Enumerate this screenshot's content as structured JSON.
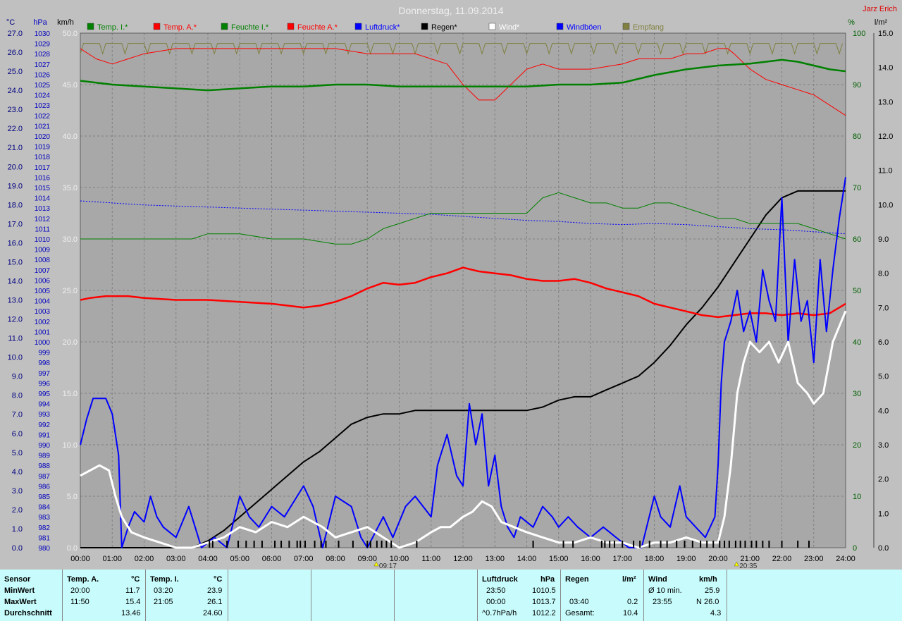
{
  "chart_data": {
    "type": "line",
    "title": "Donnerstag, 11.09.2014",
    "corner_label": "Jarz Erich",
    "axis_units": {
      "temp": "°C",
      "pressure": "hPa",
      "wind": "km/h",
      "humidity": "%",
      "rain": "l/m²"
    },
    "legend": [
      {
        "name": "Temp. I.*",
        "color": "#008000"
      },
      {
        "name": "Temp. A.*",
        "color": "#ff0000"
      },
      {
        "name": "Feuchte I.*",
        "color": "#008000"
      },
      {
        "name": "Feuchte A.*",
        "color": "#ff0000"
      },
      {
        "name": "Luftdruck*",
        "color": "#0000ff"
      },
      {
        "name": "Regen*",
        "color": "#000000"
      },
      {
        "name": "Wind*",
        "color": "#ffffff"
      },
      {
        "name": "Windböen",
        "color": "#0000ff"
      },
      {
        "name": "Empfang",
        "color": "#808040"
      }
    ],
    "x_ticks": [
      "00:00",
      "01:00",
      "02:00",
      "03:00",
      "04:00",
      "05:00",
      "06:00",
      "07:00",
      "08:00",
      "09:00",
      "10:00",
      "11:00",
      "12:00",
      "13:00",
      "14:00",
      "15:00",
      "16:00",
      "17:00",
      "18:00",
      "19:00",
      "20:00",
      "21:00",
      "22:00",
      "23:00",
      "24:00"
    ],
    "markers": [
      {
        "label": "09:17",
        "x": 9.28
      },
      {
        "label": "20:35",
        "x": 20.58
      }
    ],
    "temp_axis": {
      "min": 0,
      "max": 27,
      "step": 1
    },
    "pressure_axis": {
      "min": 980,
      "max": 1030,
      "step": 1
    },
    "wind_axis": {
      "min": 0,
      "max": 50,
      "step": 5
    },
    "humidity_axis": {
      "min": 0,
      "max": 100,
      "step": 10
    },
    "rain_axis": {
      "min": 0,
      "max": 15,
      "step": 1
    },
    "series": [
      {
        "name": "Temp. A.*",
        "axis": "temp",
        "color": "#ff0000",
        "width": 2.5,
        "x": [
          0,
          0.3,
          0.8,
          1.5,
          2,
          3,
          4,
          5,
          6,
          7,
          7.5,
          8,
          8.5,
          9,
          9.5,
          10,
          10.5,
          11,
          11.5,
          12,
          12.5,
          13,
          13.5,
          14,
          14.5,
          15,
          15.5,
          16,
          16.5,
          17,
          17.5,
          18,
          18.5,
          19,
          19.5,
          20,
          20.5,
          21,
          21.5,
          22,
          22.5,
          23,
          23.5,
          24
        ],
        "y": [
          13.0,
          13.1,
          13.2,
          13.2,
          13.1,
          13.0,
          13.0,
          12.9,
          12.8,
          12.6,
          12.7,
          12.9,
          13.2,
          13.6,
          13.9,
          13.8,
          13.9,
          14.2,
          14.4,
          14.7,
          14.5,
          14.4,
          14.3,
          14.1,
          14.0,
          14.0,
          14.1,
          13.9,
          13.6,
          13.4,
          13.2,
          12.8,
          12.6,
          12.4,
          12.2,
          12.1,
          12.2,
          12.3,
          12.3,
          12.2,
          12.3,
          12.2,
          12.3,
          12.8
        ]
      },
      {
        "name": "Temp. I.*",
        "axis": "temp",
        "color": "#008000",
        "width": 2.5,
        "x": [
          0,
          1,
          2,
          3,
          4,
          5,
          6,
          7,
          8,
          9,
          10,
          11,
          12,
          13,
          14,
          15,
          16,
          17,
          18,
          19,
          20,
          21,
          21.5,
          22,
          22.5,
          23,
          23.5,
          24
        ],
        "y": [
          24.5,
          24.3,
          24.2,
          24.1,
          24.0,
          24.1,
          24.2,
          24.2,
          24.3,
          24.3,
          24.2,
          24.2,
          24.2,
          24.2,
          24.2,
          24.3,
          24.3,
          24.4,
          24.8,
          25.1,
          25.3,
          25.4,
          25.5,
          25.6,
          25.5,
          25.3,
          25.1,
          25.0
        ]
      },
      {
        "name": "Feuchte A.*",
        "axis": "humidity",
        "color": "#ff0000",
        "width": 1,
        "x": [
          0,
          0.5,
          1,
          1.5,
          2,
          3,
          4,
          5,
          6,
          7,
          8,
          9,
          10,
          10.5,
          11,
          11.5,
          12,
          12.5,
          13,
          13.5,
          14,
          14.5,
          15,
          15.5,
          16,
          17,
          17.5,
          18,
          18.5,
          19,
          19.5,
          20,
          20.3,
          20.5,
          21,
          21.5,
          22,
          22.5,
          23,
          23.5,
          24
        ],
        "y": [
          97,
          95,
          94,
          95,
          96,
          97,
          97,
          97,
          97,
          97,
          97,
          96,
          96,
          96,
          95,
          94,
          90,
          87,
          87,
          90,
          93,
          94,
          93,
          93,
          93,
          94,
          95,
          95,
          95,
          96,
          96,
          97,
          97,
          96,
          93,
          91,
          90,
          89,
          88,
          86,
          84
        ]
      },
      {
        "name": "Feuchte I.*",
        "axis": "humidity",
        "color": "#008000",
        "width": 1,
        "x": [
          0,
          1,
          2,
          3,
          3.5,
          4,
          4.5,
          5,
          6,
          7,
          8,
          8.5,
          9,
          9.5,
          10,
          10.5,
          11,
          11.5,
          12,
          12.5,
          13,
          13.5,
          14,
          14.5,
          15,
          15.5,
          16,
          16.5,
          17,
          17.5,
          18,
          18.5,
          19,
          19.5,
          20,
          20.5,
          21,
          21.5,
          22,
          22.5,
          23,
          23.5,
          24
        ],
        "y": [
          60,
          60,
          60,
          60,
          60,
          61,
          61,
          61,
          60,
          60,
          59,
          59,
          60,
          62,
          63,
          64,
          65,
          65,
          65,
          65,
          65,
          65,
          65,
          68,
          69,
          68,
          67,
          67,
          66,
          66,
          67,
          67,
          66,
          65,
          64,
          64,
          63,
          63,
          63,
          63,
          62,
          61,
          60
        ]
      },
      {
        "name": "Luftdruck*",
        "axis": "pressure",
        "color": "#0000ff",
        "width": 1,
        "dash": "2,2",
        "x": [
          0,
          1,
          2,
          3,
          4,
          5,
          6,
          7,
          8,
          9,
          10,
          11,
          12,
          13,
          14,
          15,
          16,
          17,
          18,
          19,
          20,
          21,
          22,
          23,
          24
        ],
        "y": [
          1013.7,
          1013.5,
          1013.3,
          1013.2,
          1013.1,
          1013.0,
          1012.9,
          1012.8,
          1012.7,
          1012.6,
          1012.5,
          1012.4,
          1012.2,
          1012.0,
          1011.8,
          1011.7,
          1011.5,
          1011.4,
          1011.5,
          1011.4,
          1011.2,
          1011.0,
          1010.9,
          1010.7,
          1010.5
        ]
      },
      {
        "name": "Regen*",
        "axis": "rain",
        "color": "#000000",
        "width": 2,
        "x": [
          0,
          3.5,
          4,
          4.5,
          5,
          5.5,
          6,
          6.5,
          7,
          7.5,
          8,
          8.5,
          9,
          9.5,
          10,
          10.5,
          11,
          12,
          13,
          14,
          14.5,
          15,
          15.5,
          16,
          16.5,
          17,
          17.5,
          18,
          18.5,
          19,
          19.5,
          20,
          20.5,
          21,
          21.5,
          22,
          22.5,
          23,
          24
        ],
        "y": [
          0,
          0,
          0.2,
          0.5,
          0.9,
          1.3,
          1.7,
          2.1,
          2.5,
          2.8,
          3.2,
          3.6,
          3.8,
          3.9,
          3.9,
          4.0,
          4.0,
          4.0,
          4.0,
          4.0,
          4.1,
          4.3,
          4.4,
          4.4,
          4.6,
          4.8,
          5.0,
          5.4,
          5.9,
          6.5,
          7.0,
          7.6,
          8.3,
          9.0,
          9.7,
          10.2,
          10.4,
          10.4,
          10.4
        ]
      },
      {
        "name": "Windböen",
        "axis": "wind",
        "color": "#0000ff",
        "width": 2,
        "x": [
          0,
          0.2,
          0.4,
          0.8,
          1.0,
          1.2,
          1.3,
          1.5,
          1.7,
          2.0,
          2.2,
          2.4,
          2.6,
          3.0,
          3.4,
          3.6,
          3.8,
          4.2,
          4.6,
          5.0,
          5.3,
          5.6,
          6.0,
          6.4,
          6.8,
          7.0,
          7.3,
          7.6,
          8.0,
          8.5,
          8.8,
          9.0,
          9.5,
          9.8,
          10.2,
          10.5,
          11.0,
          11.2,
          11.5,
          11.8,
          12.0,
          12.2,
          12.4,
          12.6,
          12.8,
          13.0,
          13.2,
          13.4,
          13.6,
          13.8,
          14.2,
          14.5,
          14.8,
          15.0,
          15.3,
          15.6,
          16.0,
          16.4,
          16.8,
          17.2,
          17.6,
          18.0,
          18.2,
          18.5,
          18.8,
          19.0,
          19.3,
          19.6,
          19.9,
          20.0,
          20.1,
          20.2,
          20.4,
          20.6,
          20.8,
          21.0,
          21.2,
          21.4,
          21.6,
          21.8,
          22.0,
          22.2,
          22.4,
          22.6,
          22.8,
          23.0,
          23.2,
          23.4,
          23.6,
          23.8,
          24.0
        ],
        "y": [
          10,
          12.5,
          14.5,
          14.5,
          13,
          9,
          0,
          2,
          3.5,
          2.5,
          5,
          3,
          2,
          1,
          4,
          2,
          0,
          1,
          0,
          5,
          3,
          2,
          4,
          3,
          5,
          6,
          4,
          0,
          5,
          4,
          1,
          0,
          3,
          1,
          4,
          5,
          3,
          8,
          11,
          7,
          6,
          14,
          10,
          13,
          6,
          9,
          4,
          2,
          1,
          3,
          2,
          4,
          3,
          2,
          3,
          2,
          1,
          2,
          1,
          0,
          0,
          5,
          3,
          2,
          6,
          3,
          2,
          1,
          3,
          8,
          16,
          20,
          22,
          25,
          21,
          23,
          20,
          27,
          24,
          22,
          34,
          20,
          28,
          22,
          24,
          18,
          28,
          21,
          27,
          32,
          36
        ]
      },
      {
        "name": "Wind*",
        "axis": "wind",
        "color": "#ffffff",
        "width": 3,
        "x": [
          0,
          0.3,
          0.6,
          0.9,
          1.1,
          1.3,
          1.6,
          2.0,
          2.5,
          3.0,
          3.5,
          4.0,
          4.5,
          5.0,
          5.5,
          6.0,
          6.5,
          7.0,
          7.3,
          7.6,
          8.0,
          8.5,
          9.0,
          9.5,
          10.0,
          10.5,
          11.0,
          11.3,
          11.6,
          12.0,
          12.3,
          12.6,
          12.9,
          13.2,
          13.6,
          14.0,
          14.5,
          15.0,
          15.5,
          16.0,
          16.5,
          17.0,
          17.5,
          18.0,
          18.5,
          19.0,
          19.5,
          20.0,
          20.2,
          20.4,
          20.6,
          20.8,
          21.0,
          21.3,
          21.6,
          21.9,
          22.2,
          22.5,
          22.8,
          23.0,
          23.3,
          23.6,
          24.0
        ],
        "y": [
          7,
          7.5,
          8,
          7.5,
          5,
          3,
          1.5,
          1,
          0.5,
          0,
          0,
          0.5,
          1,
          2,
          1.5,
          2.5,
          2,
          3,
          2.5,
          2,
          1,
          1.5,
          2,
          1,
          0,
          0.5,
          1.5,
          2,
          2,
          3,
          3.5,
          4.5,
          4,
          2.5,
          2,
          1.5,
          1,
          0.5,
          0.5,
          1,
          0.5,
          0.5,
          0,
          0.5,
          0.5,
          1,
          0.5,
          0.5,
          3,
          8,
          15,
          18,
          20,
          19,
          20,
          18,
          20,
          16,
          15,
          14,
          15,
          20,
          23
        ]
      }
    ],
    "rain_marks": [
      4.05,
      4.15,
      4.6,
      4.95,
      5.2,
      5.45,
      5.7,
      6.1,
      6.3,
      6.55,
      6.8,
      6.9,
      7.05,
      7.35,
      7.55,
      7.7,
      8.1,
      8.55,
      9.0,
      9.1,
      9.3,
      9.45,
      9.6,
      9.75,
      10.55,
      14.2,
      15.15,
      15.45,
      16.35,
      16.45,
      16.6,
      16.75,
      17.0,
      17.35,
      17.55,
      17.85,
      18.2,
      18.4,
      18.7,
      18.95,
      19.2,
      19.45,
      19.65,
      19.85,
      20.05,
      20.2,
      20.35,
      20.55,
      20.7,
      20.85,
      21.05,
      21.2,
      21.4,
      21.6,
      22.0,
      22.5,
      22.85
    ],
    "empfang": {
      "base": 98,
      "dip": 96
    }
  },
  "summary": {
    "sensor": {
      "label": "Sensor",
      "rows": [
        "MinWert",
        "MaxWert",
        "Durchschnitt"
      ]
    },
    "temp_a": {
      "title": "Temp. A.",
      "unit": "°C",
      "rows": [
        [
          "20:00",
          "11.7"
        ],
        [
          "11:50",
          "15.4"
        ],
        [
          "",
          "13.46"
        ]
      ]
    },
    "temp_i": {
      "title": "Temp. I.",
      "unit": "°C",
      "rows": [
        [
          "03:20",
          "23.9"
        ],
        [
          "21:05",
          "26.1"
        ],
        [
          "",
          "24.60"
        ]
      ]
    },
    "luftdruck": {
      "title": "Luftdruck",
      "unit": "hPa",
      "rows": [
        [
          "23:50",
          "1010.5"
        ],
        [
          "00:00",
          "1013.7"
        ],
        [
          "^0.7hPa/h",
          "1012.2"
        ]
      ]
    },
    "regen": {
      "title": "Regen",
      "unit": "l/m²",
      "rows": [
        [
          "",
          ""
        ],
        [
          "03:40",
          "0.2"
        ],
        [
          "Gesamt:",
          "10.4"
        ]
      ]
    },
    "wind": {
      "title": "Wind",
      "unit": "km/h",
      "rows": [
        [
          "Ø 10 min.",
          "25.9"
        ],
        [
          "23:55",
          "N 26.0"
        ],
        [
          "",
          "4.3"
        ]
      ]
    }
  }
}
